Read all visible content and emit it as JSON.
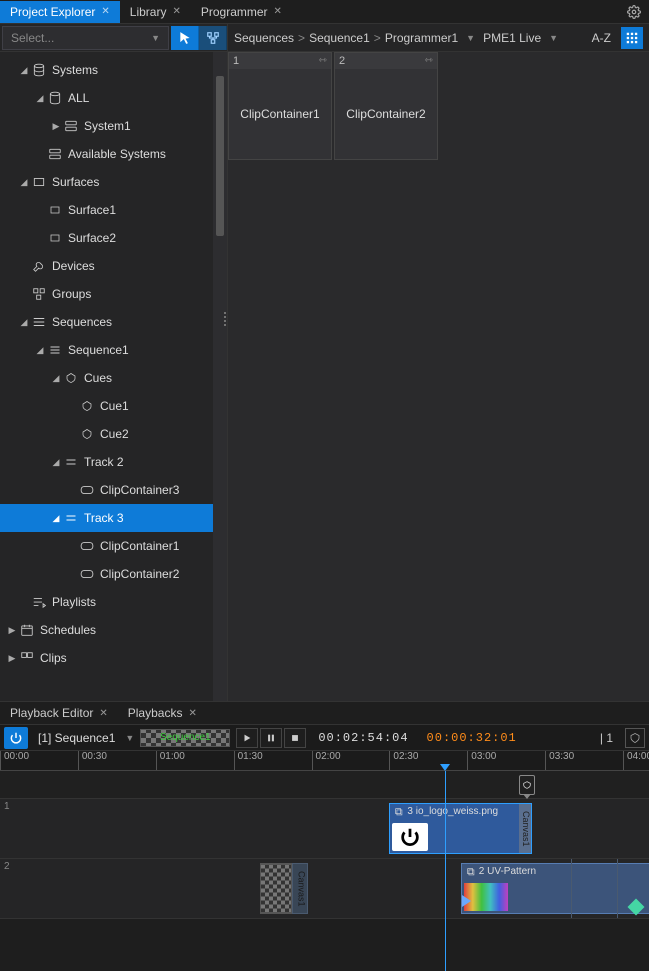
{
  "top_tabs": {
    "project_explorer": "Project Explorer",
    "library": "Library",
    "programmer": "Programmer"
  },
  "select": {
    "placeholder": "Select..."
  },
  "tree": {
    "systems": "Systems",
    "all": "ALL",
    "system1": "System1",
    "available": "Available Systems",
    "surfaces": "Surfaces",
    "surface1": "Surface1",
    "surface2": "Surface2",
    "devices": "Devices",
    "groups": "Groups",
    "sequences": "Sequences",
    "sequence1": "Sequence1",
    "cues": "Cues",
    "cue1": "Cue1",
    "cue2": "Cue2",
    "track2": "Track 2",
    "clipcontainer3": "ClipContainer3",
    "track3": "Track 3",
    "clipcontainer1": "ClipContainer1",
    "clipcontainer2": "ClipContainer2",
    "playlists": "Playlists",
    "schedules": "Schedules",
    "clips": "Clips"
  },
  "breadcrumb": {
    "sequences": "Sequences",
    "sequence1": "Sequence1",
    "programmer1": "Programmer1",
    "pme": "PME1 Live",
    "sort": "A-Z"
  },
  "clips": [
    {
      "num": "1",
      "label": "ClipContainer1"
    },
    {
      "num": "2",
      "label": "ClipContainer2"
    }
  ],
  "bottom_tabs": {
    "playback_editor": "Playback Editor",
    "playbacks": "Playbacks"
  },
  "playback": {
    "seq_label": "[1] Sequence1",
    "seq_thumb": "Sequence1",
    "tc1": "00:02:54:04",
    "tc2": "00:00:32:01",
    "count": "| 1"
  },
  "ruler": [
    "00:00",
    "00:30",
    "01:00",
    "01:30",
    "02:00",
    "02:30",
    "03:00",
    "03:30",
    "04:00"
  ],
  "timeline": {
    "track1": "1",
    "track2": "2",
    "clip1_label": "3 io_logo_weiss.png",
    "clip1_tab": "Canvas1",
    "clip2_label": "2 UV-Pattern",
    "canvas_stub": "Canvas1"
  }
}
